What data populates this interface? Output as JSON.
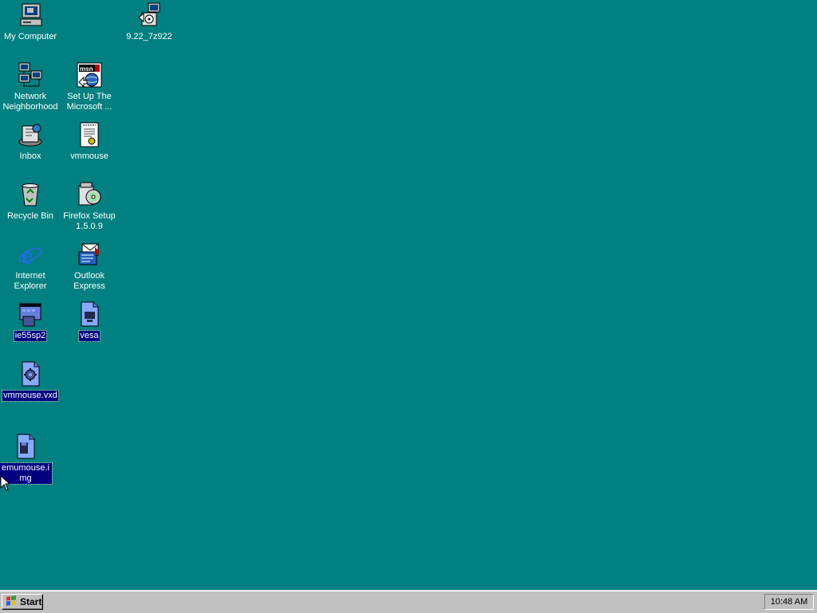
{
  "desktop": {
    "icons": [
      {
        "label": "My Computer",
        "icon": "computer-icon"
      },
      {
        "label": "9.22_7z922",
        "icon": "installer-icon"
      },
      {
        "label": "Network Neighborhood",
        "icon": "network-icon"
      },
      {
        "label": "Set Up The Microsoft ...",
        "icon": "msn-icon"
      },
      {
        "label": "Inbox",
        "icon": "inbox-icon"
      },
      {
        "label": "vmmouse",
        "icon": "document-icon"
      },
      {
        "label": "Recycle Bin",
        "icon": "recycle-bin-icon"
      },
      {
        "label": "Firefox Setup 1.5.0.9",
        "icon": "setup-icon"
      },
      {
        "label": "Internet Explorer",
        "icon": "ie-icon"
      },
      {
        "label": "Outlook Express",
        "icon": "outlook-icon"
      },
      {
        "label": "ie55sp2",
        "icon": "program-icon"
      },
      {
        "label": "vesa",
        "icon": "file-icon"
      },
      {
        "label": "vmmouse.vxd",
        "icon": "system-file-icon"
      },
      {
        "label": "emumouse.img",
        "icon": "image-file-icon"
      }
    ]
  },
  "taskbar": {
    "start_label": "Start",
    "clock": "10:48 AM"
  },
  "colors": {
    "desktop": "#008080",
    "selection": "#000080",
    "taskbar": "#c0c0c0"
  }
}
